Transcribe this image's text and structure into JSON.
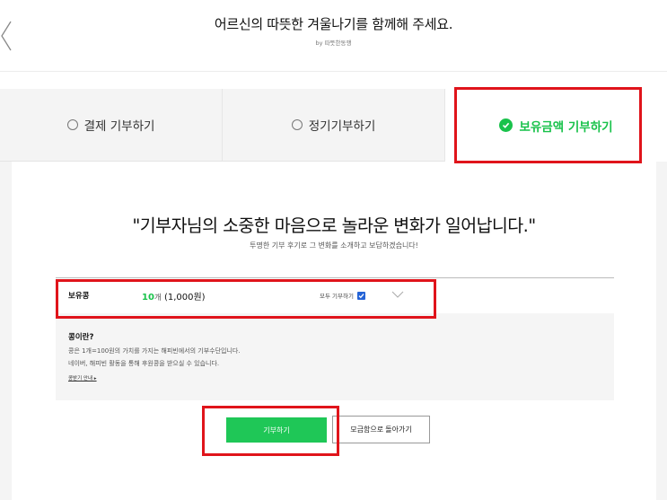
{
  "header": {
    "title": "어르신의 따뜻한 겨울나기를 함께해 주세요.",
    "subtitle": "by 따뜻한동행"
  },
  "tabs": [
    {
      "label": "결제 기부하기",
      "active": false
    },
    {
      "label": "정기기부하기",
      "active": false
    },
    {
      "label": "보유금액 기부하기",
      "active": true
    }
  ],
  "main": {
    "headline": "\"기부자님의 소중한 마음으로 놀라운 변화가 일어납니다.\"",
    "subline": "투명한 기부 후기로 그 변화를 소개하고 보답하겠습니다!"
  },
  "bean": {
    "label": "보유콩",
    "count": "10",
    "count_unit": "개",
    "amount": "(1,000원)",
    "donate_all_label": "모두 기부하기",
    "donate_all_checked": true
  },
  "bean_info": {
    "title": "콩이란?",
    "line1": "콩은 1개=100원의 가치를 가지는 해피빈에서의 기부수단입니다.",
    "line2": "네이버, 해피빈 활동을 통해 후원콩을 받으실 수 있습니다.",
    "link": "콩받기 안내 ▸"
  },
  "buttons": {
    "donate": "기부하기",
    "back_to_box": "모금함으로 돌아가기"
  },
  "colors": {
    "accent_green": "#19c24b",
    "highlight_red": "#e0141b",
    "checkbox_blue": "#2463d6"
  },
  "icons": [
    "chevron-left-icon",
    "radio-icon",
    "check-circle-icon",
    "checkbox-icon",
    "chevron-down-icon"
  ]
}
